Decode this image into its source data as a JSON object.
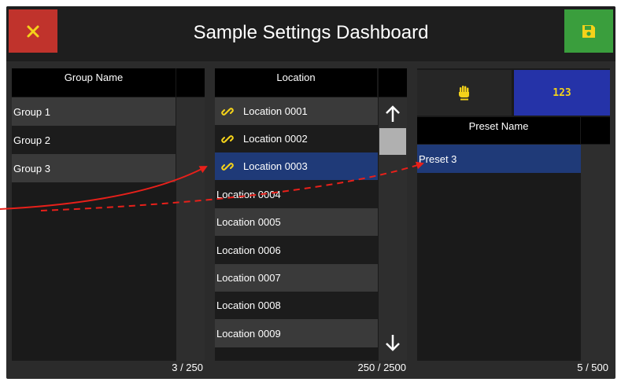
{
  "header": {
    "title": "Sample Settings Dashboard",
    "close_icon": "close-x-icon",
    "save_icon": "floppy-disk-icon",
    "colors": {
      "close": "#c0332c",
      "save": "#3a9e3d",
      "bar": "#1e1e1e"
    }
  },
  "groups": {
    "header": "Group Name",
    "items": [
      "Group 1",
      "Group 2",
      "Group 3"
    ],
    "count": "3 / 250"
  },
  "locations": {
    "header": "Location",
    "items": [
      {
        "label": "Location 0001",
        "linked": true
      },
      {
        "label": "Location 0002",
        "linked": true
      },
      {
        "label": "Location 0003",
        "linked": true,
        "selected": true
      },
      {
        "label": "Location 0004",
        "linked": false
      },
      {
        "label": "Location 0005",
        "linked": false
      },
      {
        "label": "Location 0006",
        "linked": false
      },
      {
        "label": "Location 0007",
        "linked": false
      },
      {
        "label": "Location 0008",
        "linked": false
      },
      {
        "label": "Location 0009",
        "linked": false
      }
    ],
    "count": "250 / 2500",
    "link_icon": "link-icon",
    "scroll_up_icon": "arrow-up-icon",
    "scroll_down_icon": "arrow-down-icon"
  },
  "presets": {
    "manual_mode_icon": "hand-icon",
    "numeric_mode_label": "123",
    "header": "Preset Name",
    "items": [
      "Preset 3"
    ],
    "count": "5 / 500",
    "colors": {
      "numeric_active": "#2533a8",
      "selected_row": "#1f3a78"
    }
  },
  "annotations": {
    "arrow_color": "#e8201a"
  }
}
